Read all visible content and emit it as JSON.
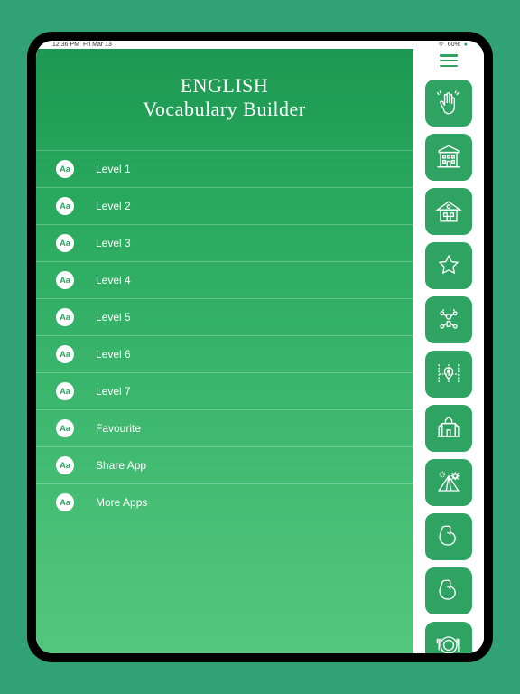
{
  "status": {
    "time": "12:36 PM",
    "date": "Fri Mar 13",
    "wifi": "wifi",
    "battery": "60%"
  },
  "header": {
    "line1": "ENGLISH",
    "line2": "Vocabulary Builder"
  },
  "menu": [
    {
      "icon": "Aa",
      "label": "Level 1"
    },
    {
      "icon": "Aa",
      "label": "Level 2"
    },
    {
      "icon": "Aa",
      "label": "Level 3"
    },
    {
      "icon": "Aa",
      "label": "Level 4"
    },
    {
      "icon": "Aa",
      "label": "Level 5"
    },
    {
      "icon": "Aa",
      "label": "Level 6"
    },
    {
      "icon": "Aa",
      "label": "Level 7"
    },
    {
      "icon": "Aa",
      "label": "Favourite"
    },
    {
      "icon": "Aa",
      "label": "Share App"
    },
    {
      "icon": "Aa",
      "label": "More Apps"
    }
  ],
  "tiles": [
    {
      "name": "wave-hand"
    },
    {
      "name": "building"
    },
    {
      "name": "house"
    },
    {
      "name": "star"
    },
    {
      "name": "people"
    },
    {
      "name": "map"
    },
    {
      "name": "castle"
    },
    {
      "name": "camping"
    },
    {
      "name": "muscle"
    },
    {
      "name": "muscle2"
    },
    {
      "name": "plate"
    }
  ],
  "colors": {
    "brand": "#2fa362"
  }
}
